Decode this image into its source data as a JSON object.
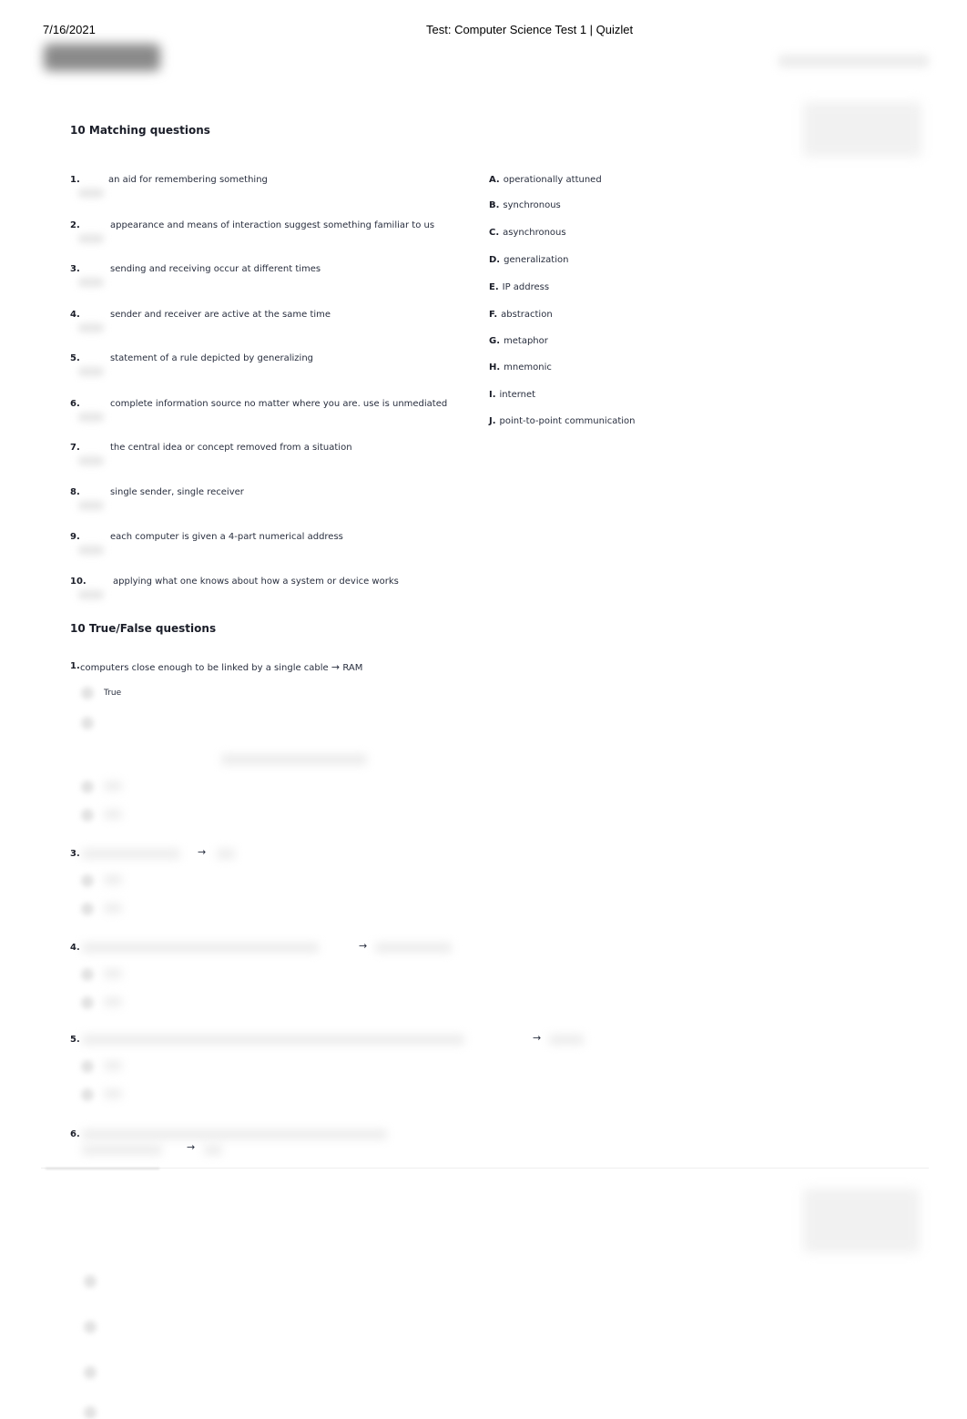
{
  "print_header": {
    "date": "7/16/2021",
    "title": "Test: Computer Science Test 1 | Quizlet"
  },
  "app": {
    "logo_text": "Quizlet"
  },
  "matching": {
    "title": "10 Matching questions",
    "questions": [
      {
        "num": "1.",
        "text": "an aid for remembering something"
      },
      {
        "num": "2.",
        "text": "appearance and means of interaction suggest something familiar to us"
      },
      {
        "num": "3.",
        "text": "sending and receiving occur at different times"
      },
      {
        "num": "4.",
        "text": "sender and receiver are active at the same time"
      },
      {
        "num": "5.",
        "text": "statement of a rule depicted by generalizing"
      },
      {
        "num": "6.",
        "text": "complete information source no matter where you are. use is unmediated"
      },
      {
        "num": "7.",
        "text": "the central idea or concept removed from a situation"
      },
      {
        "num": "8.",
        "text": "single sender, single receiver"
      },
      {
        "num": "9.",
        "text": "each computer is given a 4-part numerical address"
      },
      {
        "num": "10.",
        "text": "applying what one knows about how a system or device works"
      }
    ],
    "options": [
      {
        "letter": "A.",
        "text": "operationally attuned"
      },
      {
        "letter": "B.",
        "text": "synchronous"
      },
      {
        "letter": "C.",
        "text": "asynchronous"
      },
      {
        "letter": "D.",
        "text": "generalization"
      },
      {
        "letter": "E.",
        "text": "IP address"
      },
      {
        "letter": "F.",
        "text": "abstraction"
      },
      {
        "letter": "G.",
        "text": "metaphor"
      },
      {
        "letter": "H.",
        "text": "mnemonic"
      },
      {
        "letter": "I.",
        "text": "internet"
      },
      {
        "letter": "J.",
        "text": "point-to-point communication"
      }
    ]
  },
  "true_false": {
    "title": "10 True/False questions",
    "arrow": "→",
    "questions": [
      {
        "num": "1.",
        "text": "computers close enough to be linked by a single cable",
        "answer": "RAM",
        "choices": [
          "True",
          ""
        ]
      },
      {
        "num": "3.",
        "text": "",
        "answer": ""
      },
      {
        "num": "4.",
        "text": "",
        "answer": ""
      },
      {
        "num": "5.",
        "text": "",
        "answer": ""
      },
      {
        "num": "6.",
        "text": "",
        "answer": ""
      }
    ]
  }
}
